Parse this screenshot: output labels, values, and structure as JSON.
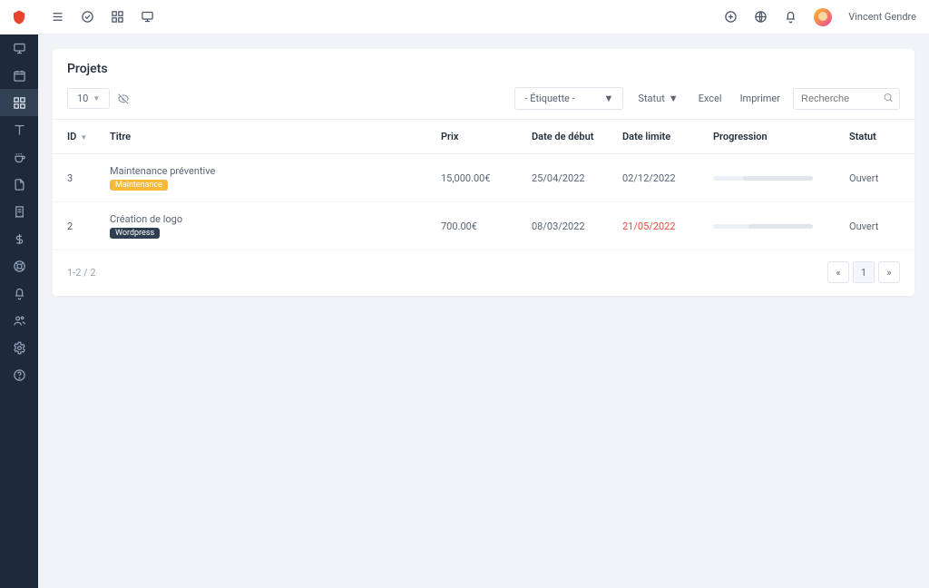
{
  "user": {
    "name": "Vincent Gendre"
  },
  "page": {
    "title": "Projets"
  },
  "toolbar": {
    "page_size": "10",
    "label_select": "- Étiquette -",
    "status_label": "Statut",
    "excel_label": "Excel",
    "print_label": "Imprimer",
    "search_placeholder": "Recherche"
  },
  "columns": {
    "id": "ID",
    "title": "Titre",
    "price": "Prix",
    "start": "Date de début",
    "deadline": "Date limite",
    "progress": "Progression",
    "status": "Statut"
  },
  "rows": [
    {
      "id": "3",
      "title": "Maintenance préventive",
      "tag": "Maintenance",
      "tag_class": "tag-yellow",
      "price": "15,000.00€",
      "start": "25/04/2022",
      "deadline": "02/12/2022",
      "deadline_overdue": false,
      "status": "Ouvert",
      "progress_rest_pct": 70
    },
    {
      "id": "2",
      "title": "Création de logo",
      "tag": "Wordpress",
      "tag_class": "tag-dark",
      "price": "700.00€",
      "start": "08/03/2022",
      "deadline": "21/05/2022",
      "deadline_overdue": true,
      "status": "Ouvert",
      "progress_rest_pct": 65
    }
  ],
  "pagination": {
    "info": "1-2 / 2",
    "current": "1"
  }
}
